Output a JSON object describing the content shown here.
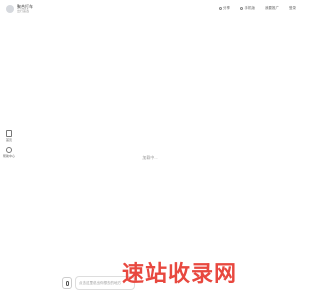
{
  "header": {
    "brand_name": "聚合打车",
    "brand_sub": "出行首选",
    "actions": [
      {
        "label": "分享"
      },
      {
        "label": "手机版"
      },
      {
        "label": "我要推广"
      },
      {
        "label": "登录"
      }
    ]
  },
  "sidebar": {
    "items": [
      {
        "label": "首页",
        "icon": "document-icon"
      },
      {
        "label": "帮助中心",
        "icon": "help-icon"
      }
    ]
  },
  "main": {
    "placeholder": "加载中..."
  },
  "composer": {
    "placeholder": "点击这里说出你想去的地方"
  },
  "watermark": {
    "text": "速站收录网"
  }
}
